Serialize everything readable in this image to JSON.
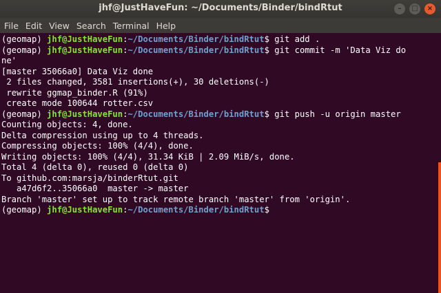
{
  "window": {
    "title": "jhf@JustHaveFun: ~/Documents/Binder/bindRtut",
    "controls": [
      {
        "icon": "minimize-icon",
        "glyph": "–"
      },
      {
        "icon": "maximize-icon",
        "glyph": "□"
      },
      {
        "icon": "close-icon",
        "glyph": "×"
      }
    ]
  },
  "menu": [
    "File",
    "Edit",
    "View",
    "Search",
    "Terminal",
    "Help"
  ],
  "prompt": {
    "env": "(geomap) ",
    "user": "jhf@JustHaveFun",
    "colon": ":",
    "path": "~/Documents/Binder/bindRtut",
    "dollar": "$ "
  },
  "terminal": {
    "lines": [
      {
        "type": "prompt",
        "cmd": "git add ."
      },
      {
        "type": "prompt",
        "cmd": "git commit -m 'Data Viz do"
      },
      {
        "type": "output",
        "text": "ne'"
      },
      {
        "type": "output",
        "text": "[master 35066a0] Data Viz done"
      },
      {
        "type": "output",
        "text": " 2 files changed, 3581 insertions(+), 30 deletions(-)"
      },
      {
        "type": "output",
        "text": " rewrite ggmap_binder.R (91%)"
      },
      {
        "type": "output",
        "text": " create mode 100644 rotter.csv"
      },
      {
        "type": "prompt",
        "cmd": "git push -u origin master"
      },
      {
        "type": "output",
        "text": "Counting objects: 4, done."
      },
      {
        "type": "output",
        "text": "Delta compression using up to 4 threads."
      },
      {
        "type": "output",
        "text": "Compressing objects: 100% (4/4), done."
      },
      {
        "type": "output",
        "text": "Writing objects: 100% (4/4), 31.34 KiB | 2.09 MiB/s, done."
      },
      {
        "type": "output",
        "text": "Total 4 (delta 0), reused 0 (delta 0)"
      },
      {
        "type": "output",
        "text": "To github.com:marsja/binderRtut.git"
      },
      {
        "type": "output",
        "text": "   a47d6f2..35066a0  master -> master"
      },
      {
        "type": "output",
        "text": "Branch 'master' set up to track remote branch 'master' from 'origin'."
      },
      {
        "type": "prompt",
        "cmd": ""
      }
    ]
  },
  "colors": {
    "background": "#300a24",
    "user": "#8ae234",
    "path": "#729fcf",
    "scrollbar": "#e95420"
  }
}
